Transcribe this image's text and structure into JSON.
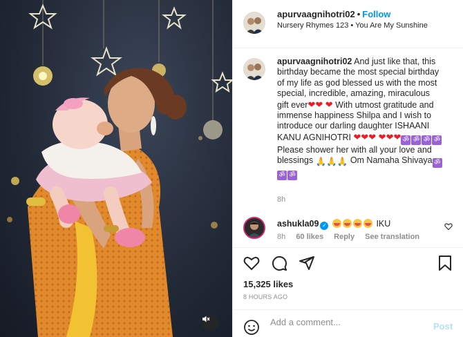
{
  "header": {
    "username": "apurvaagnihotri02",
    "separator": "•",
    "follow_label": "Follow",
    "song": "Nursery Rhymes 123 • You Are My Sunshine"
  },
  "caption": {
    "username": "apurvaagnihotri02",
    "part1": "And just like that, this birthday became the most special birthday of my life as god blessed us with the most special, incredible, amazing, miraculous gift ever",
    "part2": "With utmost gratitude and immense happiness Shilpa and I wish to introduce our darling daughter ISHAANI KANU AGNIHOTRI",
    "part3": "Please shower her with all your love and blessings",
    "part4": "Om Namaha Shivaya",
    "time": "8h"
  },
  "comment": {
    "username": "ashukla09",
    "text": "IKU",
    "time": "8h",
    "likes": "60 likes",
    "reply": "Reply",
    "translation": "See translation"
  },
  "post": {
    "likes": "15,325 likes",
    "time_ago": "8 HOURS AGO"
  },
  "add_comment": {
    "placeholder": "Add a comment...",
    "post_label": "Post"
  },
  "icons": {
    "like": "heart-icon",
    "comment": "comment-icon",
    "share": "share-icon",
    "save": "bookmark-icon",
    "emoji": "emoji-icon",
    "mute": "muted-speaker-icon",
    "verified": "verified-badge-icon"
  },
  "colors": {
    "accent": "#0095f6",
    "heart": "#ed1c24",
    "om_badge": "#9b62d6",
    "post_disabled": "#b2dffc"
  }
}
